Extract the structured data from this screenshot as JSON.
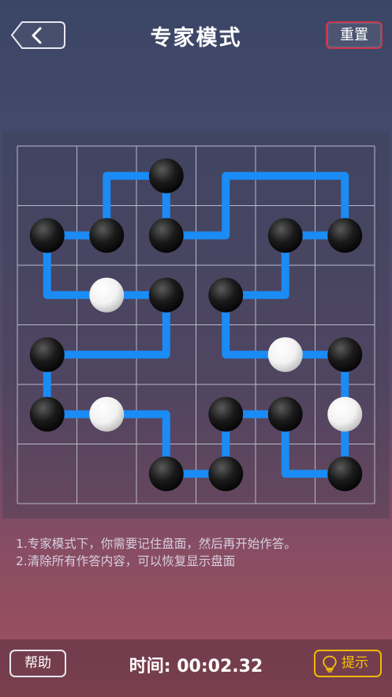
{
  "header": {
    "title": "专家模式",
    "reset_label": "重置",
    "back_icon": "chevron-left-icon"
  },
  "board": {
    "cols": 6,
    "rows": 6,
    "colors": {
      "line": "#1b8bf5",
      "black_stone": "#1a1a1a",
      "white_stone": "#f2f2f2",
      "grid": "#b9b9c6"
    },
    "stones": [
      {
        "col": 2.5,
        "row": 0.5,
        "color": "black"
      },
      {
        "col": 0.5,
        "row": 1.5,
        "color": "black"
      },
      {
        "col": 1.5,
        "row": 1.5,
        "color": "black"
      },
      {
        "col": 2.5,
        "row": 1.5,
        "color": "black"
      },
      {
        "col": 4.5,
        "row": 1.5,
        "color": "black"
      },
      {
        "col": 5.5,
        "row": 1.5,
        "color": "black"
      },
      {
        "col": 1.5,
        "row": 2.5,
        "color": "white"
      },
      {
        "col": 2.5,
        "row": 2.5,
        "color": "black"
      },
      {
        "col": 3.5,
        "row": 2.5,
        "color": "black"
      },
      {
        "col": 0.5,
        "row": 3.5,
        "color": "black"
      },
      {
        "col": 4.5,
        "row": 3.5,
        "color": "white"
      },
      {
        "col": 5.5,
        "row": 3.5,
        "color": "black"
      },
      {
        "col": 0.5,
        "row": 4.5,
        "color": "black"
      },
      {
        "col": 1.5,
        "row": 4.5,
        "color": "white"
      },
      {
        "col": 3.5,
        "row": 4.5,
        "color": "black"
      },
      {
        "col": 4.5,
        "row": 4.5,
        "color": "black"
      },
      {
        "col": 5.5,
        "row": 4.5,
        "color": "white"
      },
      {
        "col": 2.5,
        "row": 5.5,
        "color": "black"
      },
      {
        "col": 3.5,
        "row": 5.5,
        "color": "black"
      },
      {
        "col": 5.5,
        "row": 5.5,
        "color": "black"
      }
    ],
    "paths": [
      [
        [
          0.5,
          1.5
        ],
        [
          1.5,
          1.5
        ],
        [
          1.5,
          0.5
        ],
        [
          2.5,
          0.5
        ],
        [
          2.5,
          1.5
        ],
        [
          3.5,
          1.5
        ],
        [
          3.5,
          0.5
        ],
        [
          5.5,
          0.5
        ],
        [
          5.5,
          1.5
        ]
      ],
      [
        [
          0.5,
          1.5
        ],
        [
          0.5,
          2.5
        ],
        [
          2.5,
          2.5
        ]
      ],
      [
        [
          0.5,
          3.5
        ],
        [
          2.5,
          3.5
        ],
        [
          2.5,
          2.5
        ]
      ],
      [
        [
          4.5,
          1.5
        ],
        [
          5.5,
          1.5
        ]
      ],
      [
        [
          4.5,
          1.5
        ],
        [
          4.5,
          2.5
        ],
        [
          3.5,
          2.5
        ],
        [
          3.5,
          3.5
        ],
        [
          5.5,
          3.5
        ],
        [
          5.5,
          5.5
        ],
        [
          4.5,
          5.5
        ],
        [
          4.5,
          4.5
        ],
        [
          3.5,
          4.5
        ],
        [
          3.5,
          5.5
        ],
        [
          2.5,
          5.5
        ],
        [
          2.5,
          4.5
        ],
        [
          0.5,
          4.5
        ],
        [
          0.5,
          3.5
        ]
      ]
    ]
  },
  "instructions": {
    "line1": "1.专家模式下，你需要记住盘面，然后再开始作答。",
    "line2": "2.清除所有作答内容，可以恢复显示盘面"
  },
  "footer": {
    "help_label": "帮助",
    "timer_label": "时间: 00:02.32",
    "hint_label": "提示",
    "hint_icon": "lightbulb-icon",
    "hint_color": "#f5c400"
  }
}
